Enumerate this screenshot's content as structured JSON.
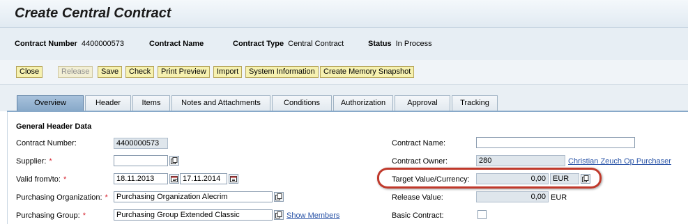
{
  "page": {
    "title": "Create Central Contract"
  },
  "info": {
    "contract_number_label": "Contract Number",
    "contract_number_value": "4400000573",
    "contract_name_label": "Contract Name",
    "contract_type_label": "Contract Type",
    "contract_type_value": "Central Contract",
    "status_label": "Status",
    "status_value": "In Process"
  },
  "toolbar": {
    "close": "Close",
    "release": "Release",
    "save": "Save",
    "check": "Check",
    "print_preview": "Print Preview",
    "import": "Import",
    "system_information": "System Information",
    "create_memory_snapshot": "Create Memory Snapshot"
  },
  "tabs": [
    {
      "label": "Overview",
      "active": true
    },
    {
      "label": "Header"
    },
    {
      "label": "Items"
    },
    {
      "label": "Notes and Attachments"
    },
    {
      "label": "Conditions"
    },
    {
      "label": "Authorization"
    },
    {
      "label": "Approval"
    },
    {
      "label": "Tracking"
    }
  ],
  "form": {
    "section_title": "General Header Data",
    "contract_number_label": "Contract Number:",
    "contract_number_value": "4400000573",
    "supplier_label": "Supplier:",
    "supplier_value": "",
    "valid_label": "Valid from/to:",
    "valid_from": "18.11.2013",
    "valid_sep": "-",
    "valid_to": "17.11.2014",
    "porg_label": "Purchasing Organization:",
    "porg_value": "Purchasing Organization Alecrim",
    "pgroup_label": "Purchasing Group:",
    "pgroup_value": "Purchasing Group Extended Classic",
    "show_members": "Show Members",
    "required_mark": "*",
    "contract_name_label": "Contract Name:",
    "contract_name_value": "",
    "contract_owner_label": "Contract Owner:",
    "contract_owner_value": "280",
    "contract_owner_link": "Christian Zeuch Op Purchaser",
    "target_value_label": "Target Value/Currency:",
    "target_value": "0,00",
    "target_currency": "EUR",
    "release_value_label": "Release Value:",
    "release_value": "0,00",
    "release_currency": "EUR",
    "basic_contract_label": "Basic Contract:",
    "basic_contract_checked": false
  },
  "colors": {
    "highlight": "#c0392b",
    "active_tab": "#88a9c9",
    "button": "#f6f1b0",
    "link": "#2a54a7",
    "required": "#d5232f"
  }
}
